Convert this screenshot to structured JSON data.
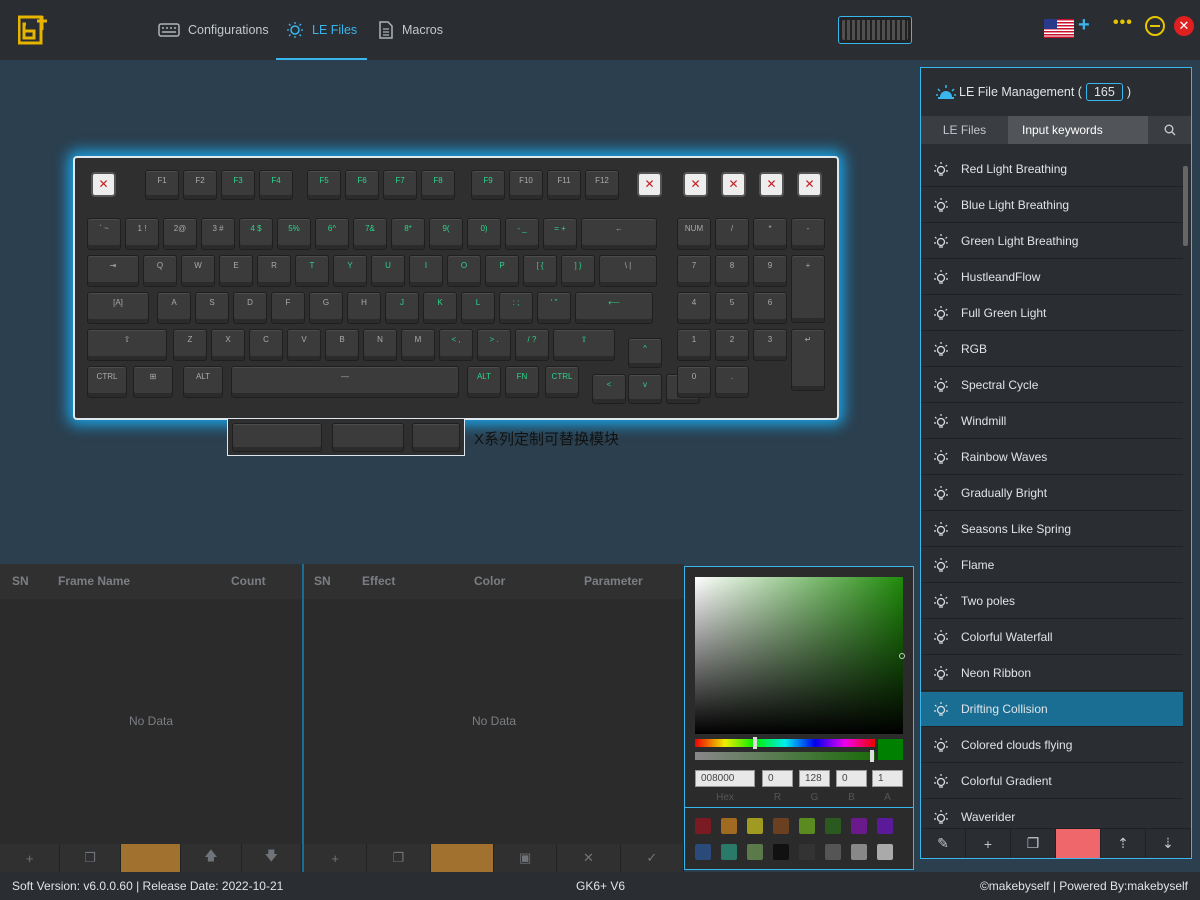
{
  "nav": {
    "tabs": [
      {
        "label": "Configurations",
        "icon": "keyboard-icon"
      },
      {
        "label": "LE Files",
        "icon": "light-bulb-icon",
        "active": true
      },
      {
        "label": "Macros",
        "icon": "document-icon"
      }
    ]
  },
  "keyboard": {
    "module_label": "X系列定制可替换模块",
    "fkeys": [
      "F1",
      "F2",
      "F3",
      "F4",
      "F5",
      "F6",
      "F7",
      "F8",
      "F9",
      "F10",
      "F11",
      "F12"
    ],
    "row1": [
      "` ~",
      "1 !",
      "2@",
      "3 #",
      "4 $",
      "5%",
      "6^",
      "7&",
      "8*",
      "9(",
      "0)",
      "- _",
      "= +",
      "←"
    ],
    "row2": [
      "⇥",
      "Q",
      "W",
      "E",
      "R",
      "T",
      "Y",
      "U",
      "I",
      "O",
      "P",
      "[ {",
      "] }",
      "\\ |"
    ],
    "row3": [
      "[A]",
      "A",
      "S",
      "D",
      "F",
      "G",
      "H",
      "J",
      "K",
      "L",
      ": ;",
      "' \"",
      "⟵"
    ],
    "row4": [
      "⇧",
      "Z",
      "X",
      "C",
      "V",
      "B",
      "N",
      "M",
      "< ,",
      "> .",
      "/ ?",
      "⇧"
    ],
    "row5": [
      "CTRL",
      "⊞",
      "ALT",
      "—",
      "ALT",
      "FN",
      "CTRL"
    ],
    "numpad_r1": [
      "NUM",
      "/",
      "*",
      "-"
    ],
    "numpad_r2": [
      "7",
      "8",
      "9",
      "+"
    ],
    "numpad_r3": [
      "4",
      "5",
      "6"
    ],
    "numpad_r4": [
      "1",
      "2",
      "3",
      "↵"
    ],
    "numpad_r5": [
      "0",
      "."
    ],
    "arrows": [
      "^",
      "<",
      "v",
      ">"
    ]
  },
  "frames_panel": {
    "headers": [
      "SN",
      "Frame Name",
      "Count"
    ],
    "empty": "No Data"
  },
  "effects_panel": {
    "headers": [
      "SN",
      "Effect",
      "Color",
      "Parameter"
    ],
    "empty": "No Data"
  },
  "color_picker": {
    "hex": "008000",
    "r": "0",
    "g": "128",
    "b": "0",
    "a": "1",
    "labels": [
      "Hex",
      "R",
      "G",
      "B",
      "A"
    ],
    "current_color": "#008000",
    "swatches": [
      "#7a1a22",
      "#a06a20",
      "#a09a20",
      "#6a4020",
      "#5a8a20",
      "#2a5a20",
      "#6a1a8a",
      "#5a1a9a",
      "#2a4a7a",
      "#2a7a6a",
      "#5a7a4a",
      "#111111",
      "#333333",
      "#555555",
      "#888888",
      "#aaaaaa"
    ]
  },
  "right_panel": {
    "title": "LE File Management (",
    "count": "165",
    "title_end": ")",
    "tab_lefiles": "LE Files",
    "search_placeholder": "Input keywords",
    "items": [
      "Red Light Breathing",
      "Blue Light Breathing",
      "Green Light Breathing",
      "HustleandFlow",
      "Full Green Light",
      "RGB",
      "Spectral Cycle",
      "Windmill",
      "Rainbow Waves",
      "Gradually Bright",
      "Seasons Like Spring",
      "Flame",
      "Two poles",
      "Colorful Waterfall",
      "Neon Ribbon",
      "Drifting Collision",
      "Colored clouds flying",
      "Colorful Gradient",
      "Waverider"
    ],
    "selected_index": 15
  },
  "status": {
    "version": "Soft Version: v6.0.0.60 | Release Date: 2022-10-21",
    "model": "GK6+ V6",
    "credit": "©makebyself | Powered By:makebyself"
  }
}
